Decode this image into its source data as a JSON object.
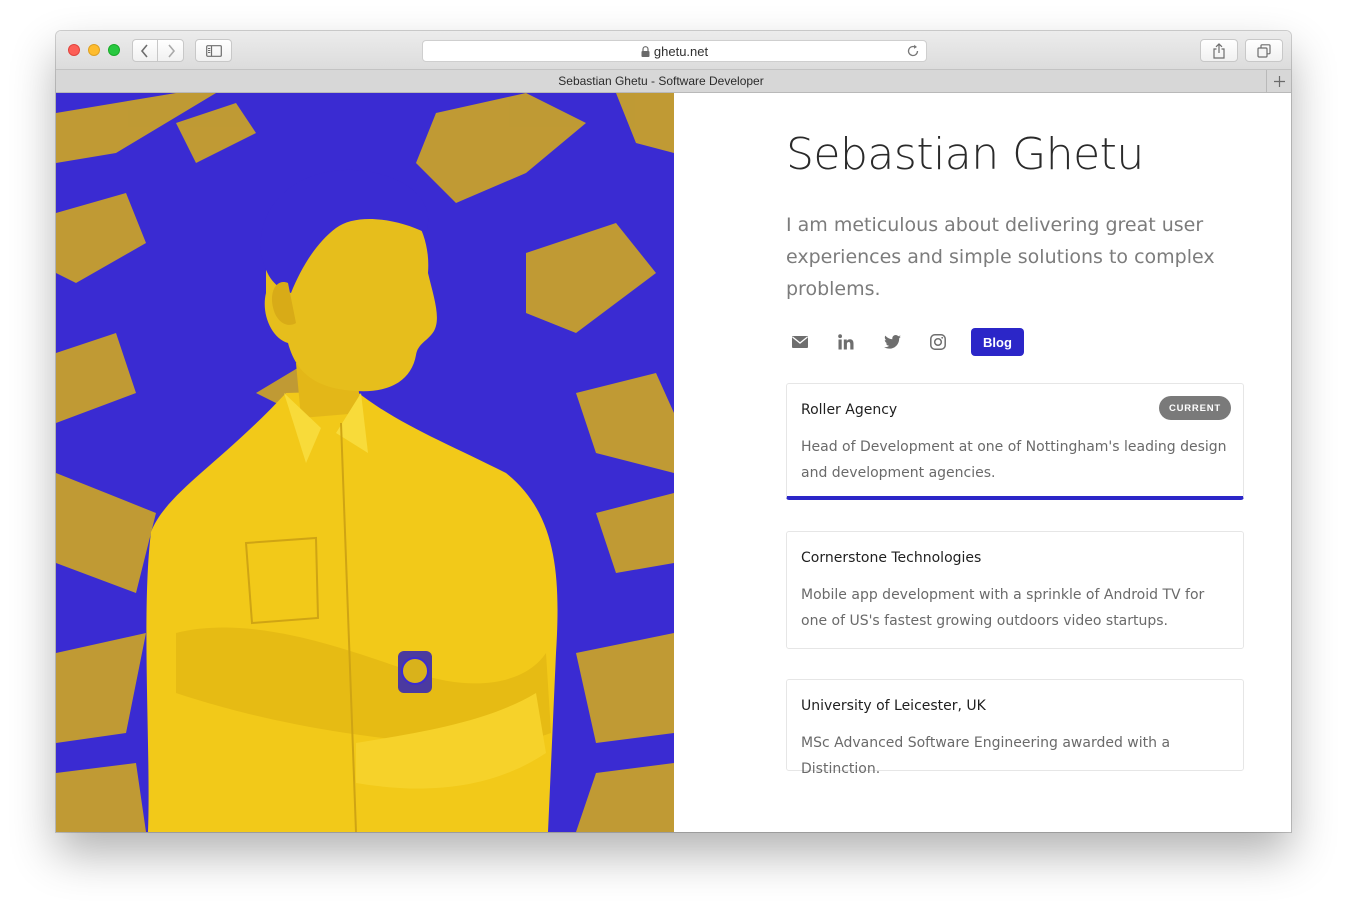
{
  "browser": {
    "url": "ghetu.net",
    "tab_title": "Sebastian Ghetu - Software Developer",
    "icons": {
      "back": "chevron-left-icon",
      "forward": "chevron-right-icon",
      "sidebar": "sidebar-icon",
      "lock": "lock-icon",
      "reload": "reload-icon",
      "share": "share-icon",
      "tabs": "tabs-overview-icon",
      "new_tab": "plus-icon"
    }
  },
  "profile": {
    "name": "Sebastian Ghetu",
    "tagline": "I am meticulous about delivering great user experiences and simple solutions to complex problems.",
    "photo_colors": {
      "background": "#3a2bd2",
      "subject": "#f2c919"
    }
  },
  "socials": [
    {
      "icon": "email-icon"
    },
    {
      "icon": "linkedin-icon"
    },
    {
      "icon": "twitter-icon"
    },
    {
      "icon": "instagram-icon"
    }
  ],
  "blog_label": "Blog",
  "accent_color": "#2b26c8",
  "experience": [
    {
      "title": "Roller Agency",
      "badge": "CURRENT",
      "description": "Head of Development at one of Nottingham's leading design and development agencies."
    },
    {
      "title": "Cornerstone Technologies",
      "description": "Mobile app development with a sprinkle of Android TV for one of US's fastest growing outdoors video startups."
    },
    {
      "title": "University of Leicester, UK",
      "description": "MSc Advanced Software Engineering awarded with a Distinction."
    }
  ]
}
